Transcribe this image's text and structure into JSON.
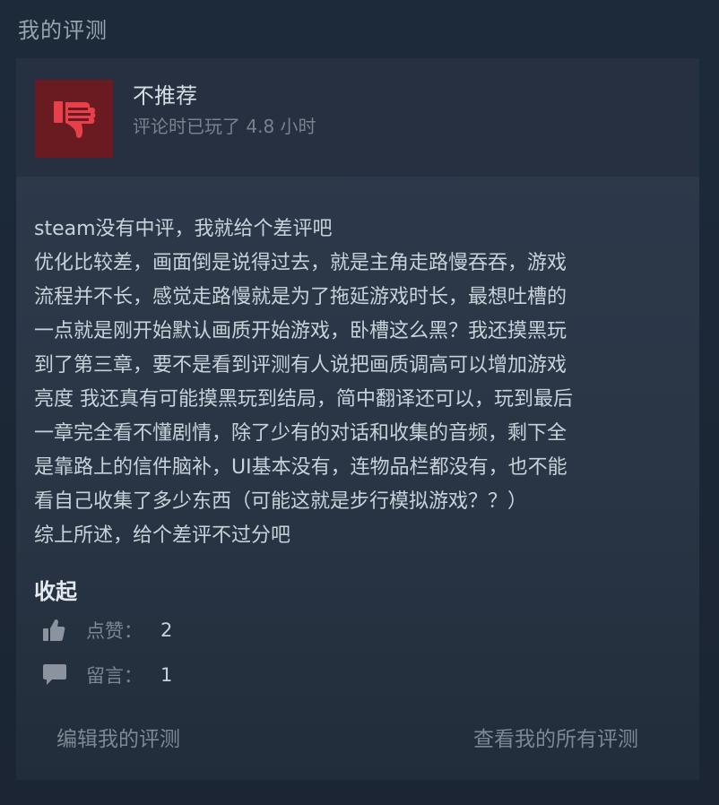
{
  "section_title": "我的评测",
  "review": {
    "recommendation": "不推荐",
    "playtime": "评论时已玩了 4.8 小时",
    "body_lines": [
      "steam没有中评，我就给个差评吧",
      "优化比较差，画面倒是说得过去，就是主角走路慢吞吞，游戏",
      "流程并不长，感觉走路慢就是为了拖延游戏时长，最想吐槽的",
      "一点就是刚开始默认画质开始游戏，卧槽这么黑？我还摸黑玩",
      "到了第三章，要不是看到评测有人说把画质调高可以增加游戏",
      "亮度 我还真有可能摸黑玩到结局，简中翻译还可以，玩到最后",
      "一章完全看不懂剧情，除了少有的对话和收集的音频，剩下全",
      "是靠路上的信件脑补，UI基本没有，连物品栏都没有，也不能",
      "看自己收集了多少东西（可能这就是步行模拟游戏？？）",
      "综上所述，给个差评不过分吧"
    ],
    "collapse_label": "收起",
    "likes": {
      "label": "点赞：",
      "value": "2",
      "icon": "thumbs-up-icon"
    },
    "comments": {
      "label": "留言：",
      "value": "1",
      "icon": "speech-bubble-icon"
    }
  },
  "footer": {
    "edit_label": "编辑我的评测",
    "view_all_label": "查看我的所有评测"
  },
  "colors": {
    "thumb_bg": "#6a1b22",
    "thumb_fg": "#e8404a"
  }
}
